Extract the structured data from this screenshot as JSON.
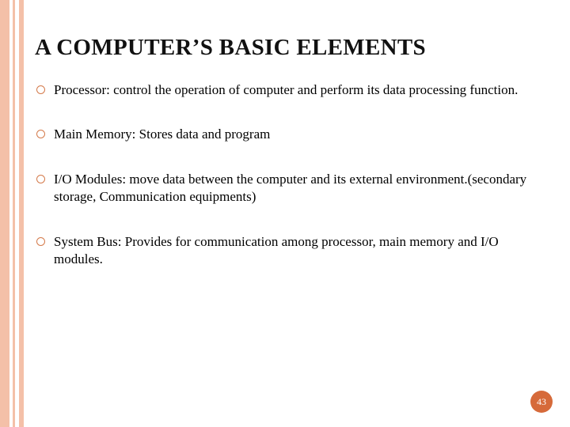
{
  "title": "A COMPUTER’S BASIC ELEMENTS",
  "bullets": [
    "Processor: control the operation of computer and perform its data processing function.",
    "Main Memory: Stores data and program",
    "I/O Modules: move data between the computer and its external environment.(secondary storage, Communication equipments)",
    "System Bus: Provides for communication among processor, main memory and I/O modules."
  ],
  "page_number": "43"
}
